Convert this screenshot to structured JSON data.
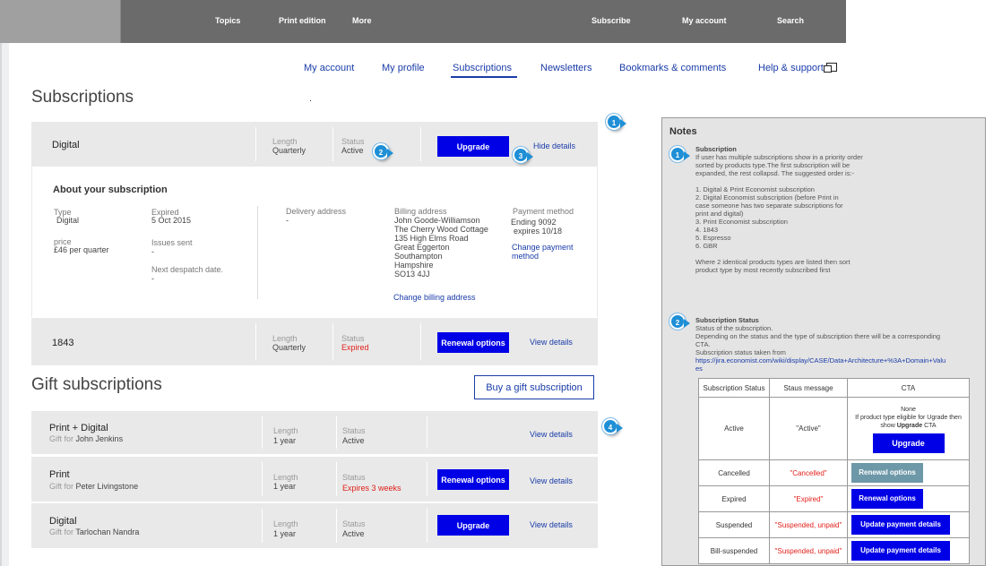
{
  "topnav": {
    "items": [
      "Topics",
      "Print edition",
      "More",
      "Subscribe",
      "My account",
      "Search"
    ]
  },
  "subnav": {
    "items": [
      "My account",
      "My profile",
      "Subscriptions",
      "Newsletters",
      "Bookmarks & comments",
      "Help & support"
    ],
    "active": "Subscriptions"
  },
  "subscriptions": {
    "title": "Subscriptions",
    "dot": ".",
    "labels": {
      "length": "Length",
      "status": "Status"
    },
    "digital": {
      "name": "Digital",
      "length": "Quarterly",
      "status": "Active",
      "button": "Upgrade",
      "link": "Hide details"
    },
    "details": {
      "heading": "About your subscription",
      "type_label": "Type",
      "type_value": "Digital",
      "price_label": "price",
      "price_value": "£46 per quarter",
      "expired_label": "Expired",
      "expired_value": "5 Oct 2015",
      "issues_label": "Issues sent",
      "issues_value": "-",
      "despatch_label": "Next despatch date.",
      "despatch_value": "-",
      "delivery_label": "Delivery address",
      "delivery_value": "-",
      "billing_label": "Billing address",
      "billing_lines": [
        "John Goode-Williamson",
        "The Cherry Wood Cottage",
        "135 High Elms Road",
        "Great Eggerton",
        "Southampton",
        "Hampshire",
        "SO13 4JJ"
      ],
      "billing_link": "Change billing address",
      "payment_label": "Payment method",
      "payment_ending": "Ending 9092",
      "payment_expires": "expires 10/18",
      "payment_link_1": "Change payment",
      "payment_link_2": "method"
    },
    "row1843": {
      "name": "1843",
      "length": "Quarterly",
      "status": "Expired",
      "button": "Renewal options",
      "link": "View details"
    }
  },
  "gifts": {
    "title": "Gift subscriptions",
    "buy_button": "Buy a gift subscription",
    "gift_for": "Gift for",
    "rows": [
      {
        "name": "Print + Digital",
        "recipient": "John Jenkins",
        "length": "1 year",
        "status": "Active",
        "button": "",
        "link": "View details"
      },
      {
        "name": "Print",
        "recipient": "Peter Livingstone",
        "length": "1 year",
        "status": "Expires 3 weeks",
        "button": "Renewal options",
        "link": "View details"
      },
      {
        "name": "Digital",
        "recipient": "Tarlochan Nandra",
        "length": "1 year",
        "status": "Active",
        "button": "Upgrade",
        "link": "View details"
      }
    ]
  },
  "markers": [
    "1",
    "2",
    "3",
    "4"
  ],
  "notes": {
    "title": "Notes",
    "n1_title": "Subscription",
    "n1_lines": [
      "If user has multiple subscriptions show in a priority order",
      "sorted by products type.The first subscription will be",
      "expanded, the rest collapsd. The suggested order is:-"
    ],
    "n1_list": [
      "1. Digital & Print Economist subscription",
      "2. Digital Economist subscription (before Print in",
      "case someone has two separate subscriptions for",
      "print and digital)",
      "3. Print Economist subscription",
      "4. 1843",
      "5. Espresso",
      "6. GBR"
    ],
    "n1_footer": [
      "Where 2 identical products types are listed then sort",
      "product type by most recently subscribed first"
    ],
    "n2_title": "Subscription Status",
    "n2_lines": [
      "Status of the subscription.",
      "Depending on the status and the type of subscription there will be a corresponding",
      "CTA.",
      "Subscription status taken from"
    ],
    "n2_link_1": "https://jira.economist.com/wiki/display/CASE/Data+Architecture+%3A+Domain+Valu",
    "n2_link_2": "es",
    "table": {
      "headers": [
        "Subscription Status",
        "Staus message",
        "CTA"
      ],
      "active_cta_none": "None",
      "active_cta_note_1": "If product type eligible for Ugrade then",
      "active_cta_note_2": "show",
      "active_cta_note_bold": "Upgrade",
      "active_cta_note_3": "CTA",
      "rows": [
        {
          "status": "Active",
          "message": "\"Active\"",
          "cta": "Upgrade"
        },
        {
          "status": "Cancelled",
          "message": "\"Cancelled\"",
          "cta": "Renewal options"
        },
        {
          "status": "Expired",
          "message": "\"Expired\"",
          "cta": "Renewal options"
        },
        {
          "status": "Suspended",
          "message": "\"Suspended, unpaid\"",
          "cta": "Update payment details"
        },
        {
          "status": "Bill-suspended",
          "message": "\"Suspended, unpaid\"",
          "cta": "Update payment details"
        }
      ]
    }
  }
}
